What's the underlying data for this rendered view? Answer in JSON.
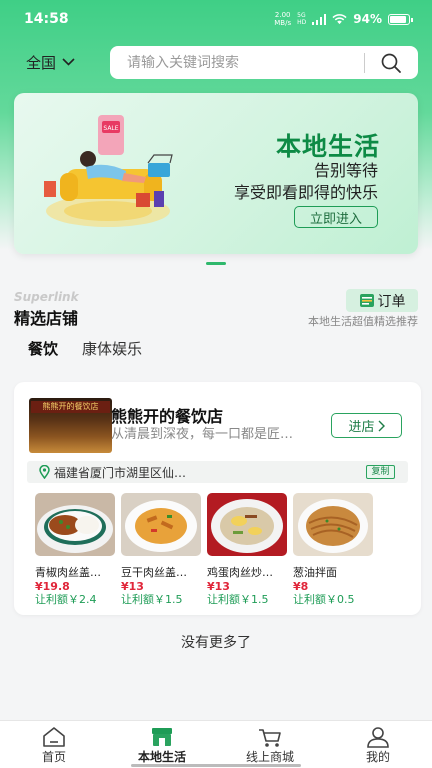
{
  "status_bar": {
    "time": "14:58",
    "net_speed_value": "2.00",
    "net_speed_unit": "MB/s",
    "signal_label_top": "5G",
    "signal_label_bottom": "HD",
    "battery": "94%"
  },
  "header": {
    "region": "全国",
    "search_placeholder": "请输入关键词搜索"
  },
  "banner": {
    "title": "本地生活",
    "subtitle1": "告别等待",
    "subtitle2": "享受即看即得的快乐",
    "button": "立即进入",
    "art_sale_text": "SALE"
  },
  "section": {
    "brand_en": "Superlink",
    "title": "精选店铺",
    "order_button": "订单",
    "note": "本地生活超值精选推荐"
  },
  "tabs": [
    {
      "label": "餐饮",
      "active": true
    },
    {
      "label": "康体娱乐",
      "active": false
    }
  ],
  "shop": {
    "sign_text": "熊熊开的餐饮店",
    "name": "熊熊开的餐饮店",
    "description": "从清晨到深夜，每一口都是匠…",
    "enter_button": "进店",
    "address": "福建省厦门市湖里区仙…",
    "copy_button": "复制",
    "dishes": [
      {
        "name": "青椒肉丝盖…",
        "price": "¥19.8",
        "rebate": "让利额￥2.4"
      },
      {
        "name": "豆干肉丝盖…",
        "price": "¥13",
        "rebate": "让利额￥1.5"
      },
      {
        "name": "鸡蛋肉丝炒…",
        "price": "¥13",
        "rebate": "让利额￥1.5"
      },
      {
        "name": "葱油拌面",
        "price": "¥8",
        "rebate": "让利额￥0.5"
      }
    ]
  },
  "footer_text": "没有更多了",
  "bottom_nav": [
    {
      "label": "首页",
      "icon": "home-icon",
      "active": false
    },
    {
      "label": "本地生活",
      "icon": "local-shop-icon",
      "active": true
    },
    {
      "label": "线上商城",
      "icon": "cart-icon",
      "active": false
    },
    {
      "label": "我的",
      "icon": "profile-icon",
      "active": false
    }
  ],
  "colors": {
    "brand_green": "#1e9c56",
    "price_red": "#e0263a",
    "header_gradient_top": "#3fcf86"
  }
}
